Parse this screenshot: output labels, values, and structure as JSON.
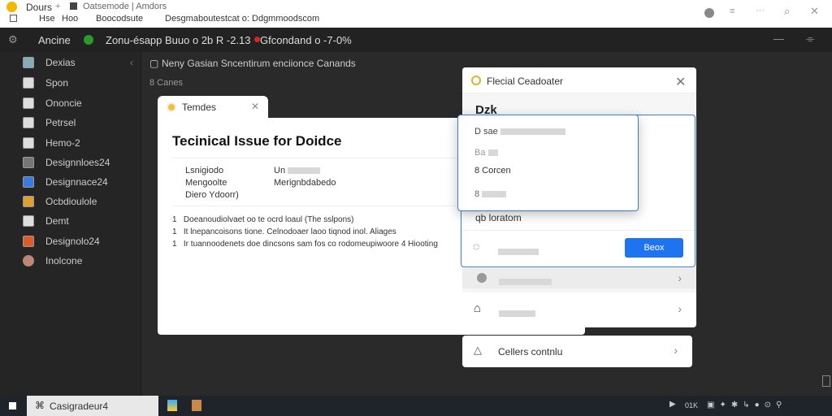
{
  "browser": {
    "tab_title": "Dours",
    "tab_add": "+",
    "tab2_title": "Oatsemode | Amdors",
    "bookmarks": [
      "Hse",
      "Hoo",
      "Boocodsute",
      "Desgmaboutestcat o: Ddgmmoodscom"
    ]
  },
  "menubar": {
    "items": [
      "Ancine",
      "Zonu-ésapp",
      "Buuo o 2b R -2.13",
      "Gfcondand o -7-0%"
    ]
  },
  "sidebar": {
    "items": [
      {
        "label": "Dexias"
      },
      {
        "label": "Spon"
      },
      {
        "label": "Ononcie"
      },
      {
        "label": "Petrsel"
      },
      {
        "label": "Hemo-2"
      },
      {
        "label": "Designnloes24"
      },
      {
        "label": "Designnace24"
      },
      {
        "label": "Ocbdioulole"
      },
      {
        "label": "Demt"
      },
      {
        "label": "Designolo24"
      },
      {
        "label": "Inolcone"
      }
    ]
  },
  "breadcrumb": {
    "line1": "Neny Gasian Sncentirum enciionce Canands",
    "line2": "8 Canes"
  },
  "dialog": {
    "tab_label": "Temdes",
    "title": "Tecinical Issue for Doidce",
    "fields": [
      {
        "label": "Lsnigiodo",
        "value": "Un"
      },
      {
        "label": "Mengoolte",
        "value": "Merignbdabedo"
      },
      {
        "label": "Diero Ydoorr)",
        "value": ""
      }
    ],
    "bullets": [
      "Doeanoudiolvaet oo te ocrd loaul (The sslpons)",
      "It lnepancoisons tione. Celnodoaer laoo tiqnod inol. Aliages",
      "Ir tuannoodenets doe dincsons sam fos co rodomeupiwoore 4 Hiooting"
    ]
  },
  "panel": {
    "title": "Flecial Ceadoater",
    "heading": "Dzk",
    "row_label": "qb loratom",
    "button": "Beox",
    "card_label": "Cellers contnlu"
  },
  "popup": {
    "items": [
      "D sae",
      "Ba",
      "8 Corcen",
      "8"
    ]
  },
  "taskbar": {
    "app": "Casigradeur4",
    "tray_text": "01K"
  },
  "colors": {
    "accent": "#1e74f0",
    "dark": "#222222"
  }
}
